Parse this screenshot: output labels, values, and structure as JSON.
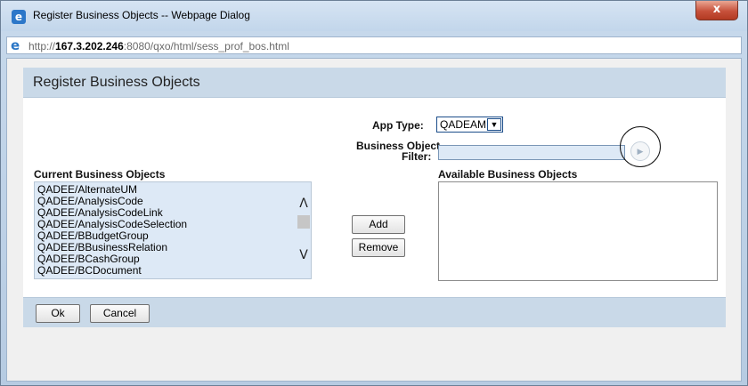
{
  "window": {
    "title": "Register Business Objects -- Webpage Dialog",
    "close_glyph": "x",
    "url_prefix": "http://",
    "url_host": "167.3.202.246",
    "url_rest": ":8080/qxo/html/sess_prof_bos.html"
  },
  "panel": {
    "title": "Register Business Objects"
  },
  "form": {
    "app_type_label": "App Type:",
    "app_type_value": "QADEAM",
    "bo_filter_label_line1": "Business Object",
    "bo_filter_label_line2": "Filter:",
    "bo_filter_value": ""
  },
  "current": {
    "label": "Current Business Objects",
    "items": [
      "QADEE/AlternateUM",
      "QADEE/AnalysisCode",
      "QADEE/AnalysisCodeLink",
      "QADEE/AnalysisCodeSelection",
      "QADEE/BBudgetGroup",
      "QADEE/BBusinessRelation",
      "QADEE/BCashGroup",
      "QADEE/BCDocument"
    ]
  },
  "available": {
    "label": "Available Business Objects",
    "items": []
  },
  "buttons": {
    "add": "Add",
    "remove": "Remove",
    "ok": "Ok",
    "cancel": "Cancel"
  },
  "icons": {
    "window": "ie-page-icon",
    "address": "ie-logo-icon",
    "go": "play-arrow-icon"
  },
  "colors": {
    "header_bg": "#c9d9e8",
    "list_bg": "#dde9f6",
    "close_red": "#c7513b"
  }
}
